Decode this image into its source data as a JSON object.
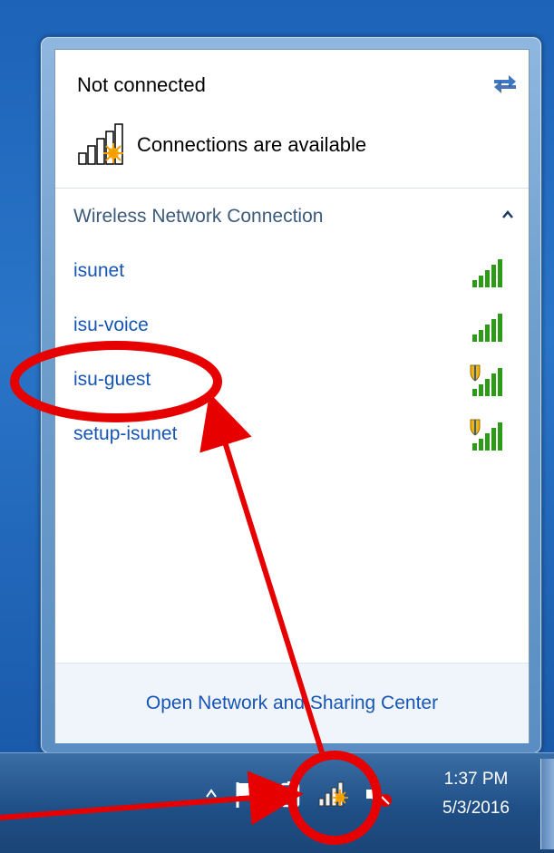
{
  "status": {
    "title": "Not connected",
    "availability": "Connections are available"
  },
  "wireless": {
    "section_title": "Wireless Network Connection",
    "networks": [
      {
        "name": "isunet",
        "secured": false
      },
      {
        "name": "isu-voice",
        "secured": false
      },
      {
        "name": "isu-guest",
        "secured": true
      },
      {
        "name": "setup-isunet",
        "secured": true
      }
    ]
  },
  "footer": {
    "link_label": "Open Network and Sharing Center"
  },
  "taskbar": {
    "time": "1:37 PM",
    "date": "5/3/2016"
  },
  "icons": {
    "refresh": "refresh-icon",
    "collapse": "chevron-up-icon",
    "signal": "signal-bars-icon",
    "shield": "shield-icon"
  },
  "colors": {
    "link": "#1655b5",
    "signal_green": "#2e9b18",
    "annotation_red": "#e60000"
  }
}
